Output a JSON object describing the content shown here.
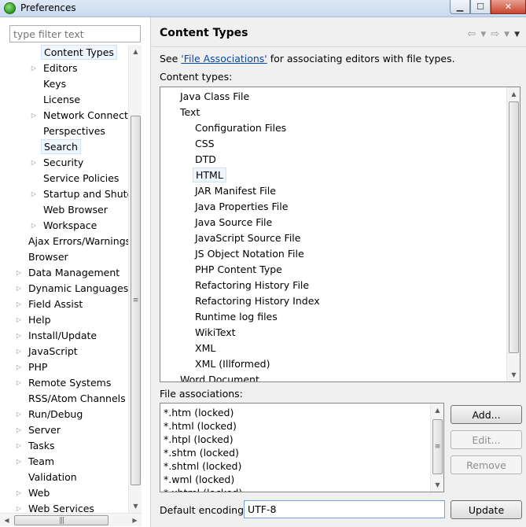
{
  "window": {
    "title": "Preferences",
    "min_glyph": "▁",
    "max_glyph": "☐",
    "close_glyph": "✕"
  },
  "left": {
    "filter_placeholder": "type filter text",
    "tree": [
      {
        "label": "Content Types",
        "indent": 1,
        "arrow": false,
        "selected": true
      },
      {
        "label": "Editors",
        "indent": 1,
        "arrow": true
      },
      {
        "label": "Keys",
        "indent": 1,
        "arrow": false
      },
      {
        "label": "License",
        "indent": 1,
        "arrow": false
      },
      {
        "label": "Network Connectio",
        "indent": 1,
        "arrow": true
      },
      {
        "label": "Perspectives",
        "indent": 1,
        "arrow": false
      },
      {
        "label": "Search",
        "indent": 1,
        "arrow": false,
        "selected": true
      },
      {
        "label": "Security",
        "indent": 1,
        "arrow": true
      },
      {
        "label": "Service Policies",
        "indent": 1,
        "arrow": false
      },
      {
        "label": "Startup and Shutd",
        "indent": 1,
        "arrow": true
      },
      {
        "label": "Web Browser",
        "indent": 1,
        "arrow": false
      },
      {
        "label": "Workspace",
        "indent": 1,
        "arrow": true
      },
      {
        "label": "Ajax Errors/Warnings",
        "indent": 0,
        "arrow": false
      },
      {
        "label": "Browser",
        "indent": 0,
        "arrow": false
      },
      {
        "label": "Data Management",
        "indent": 0,
        "arrow": true
      },
      {
        "label": "Dynamic Languages",
        "indent": 0,
        "arrow": true
      },
      {
        "label": "Field Assist",
        "indent": 0,
        "arrow": true
      },
      {
        "label": "Help",
        "indent": 0,
        "arrow": true
      },
      {
        "label": "Install/Update",
        "indent": 0,
        "arrow": true
      },
      {
        "label": "JavaScript",
        "indent": 0,
        "arrow": true
      },
      {
        "label": "PHP",
        "indent": 0,
        "arrow": true
      },
      {
        "label": "Remote Systems",
        "indent": 0,
        "arrow": true
      },
      {
        "label": "RSS/Atom Channels",
        "indent": 0,
        "arrow": false
      },
      {
        "label": "Run/Debug",
        "indent": 0,
        "arrow": true
      },
      {
        "label": "Server",
        "indent": 0,
        "arrow": true
      },
      {
        "label": "Tasks",
        "indent": 0,
        "arrow": true
      },
      {
        "label": "Team",
        "indent": 0,
        "arrow": true
      },
      {
        "label": "Validation",
        "indent": 0,
        "arrow": false
      },
      {
        "label": "Web",
        "indent": 0,
        "arrow": true
      },
      {
        "label": "Web Services",
        "indent": 0,
        "arrow": true
      }
    ]
  },
  "right": {
    "title": "Content Types",
    "desc_prefix": "See ",
    "desc_link": "'File Associations'",
    "desc_suffix": " for associating editors with file types.",
    "content_types_label": "Content types:",
    "content_types": [
      {
        "label": "Java Class File",
        "indent": 0
      },
      {
        "label": "Text",
        "indent": 0
      },
      {
        "label": "Configuration Files",
        "indent": 1
      },
      {
        "label": "CSS",
        "indent": 1
      },
      {
        "label": "DTD",
        "indent": 1
      },
      {
        "label": "HTML",
        "indent": 1,
        "selected": true
      },
      {
        "label": "JAR Manifest File",
        "indent": 1
      },
      {
        "label": "Java Properties File",
        "indent": 1
      },
      {
        "label": "Java Source File",
        "indent": 1
      },
      {
        "label": "JavaScript Source File",
        "indent": 1
      },
      {
        "label": "JS Object Notation File",
        "indent": 1
      },
      {
        "label": "PHP Content Type",
        "indent": 1
      },
      {
        "label": "Refactoring History File",
        "indent": 1
      },
      {
        "label": "Refactoring History Index",
        "indent": 1
      },
      {
        "label": "Runtime log files",
        "indent": 1
      },
      {
        "label": "WikiText",
        "indent": 1
      },
      {
        "label": "XML",
        "indent": 1
      },
      {
        "label": "XML (Illformed)",
        "indent": 1
      },
      {
        "label": "Word Document",
        "indent": 0
      }
    ],
    "file_assoc_label": "File associations:",
    "file_associations": [
      "*.htm (locked)",
      "*.html (locked)",
      "*.htpl (locked)",
      "*.shtm (locked)",
      "*.shtml (locked)",
      "*.wml (locked)",
      "*.xhtml (locked)"
    ],
    "buttons": {
      "add": "Add...",
      "edit": "Edit...",
      "remove": "Remove",
      "update": "Update"
    },
    "encoding_label": "Default encoding:",
    "encoding_value": "UTF-8"
  }
}
